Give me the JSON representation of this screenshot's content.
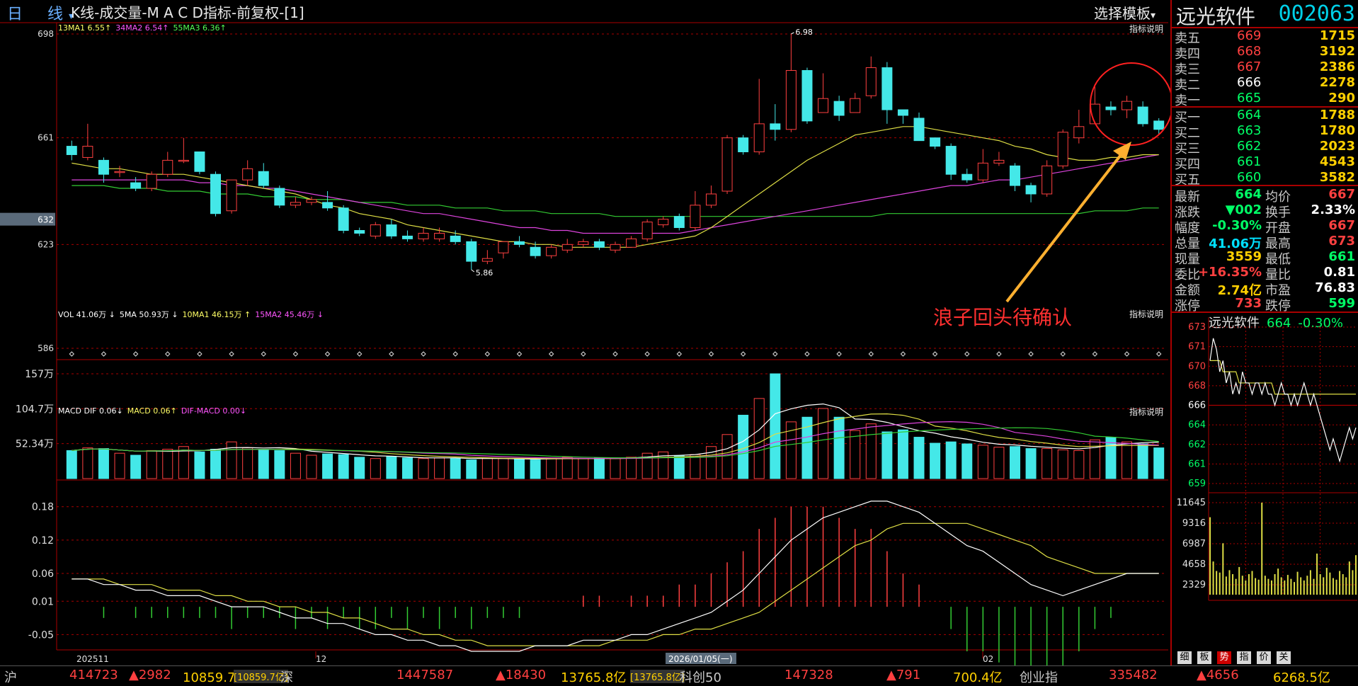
{
  "topbar": {
    "period_label": "日 线",
    "title": "K线-成交量-M A C D指标-前复权-[1]",
    "template_button": "选择模板",
    "dropdown_glyph": "▾"
  },
  "stock": {
    "name": "远光软件",
    "code": "002063"
  },
  "legends": {
    "ma": [
      {
        "text": "13MA1 6.55↑",
        "color": "#ffff66"
      },
      {
        "text": "34MA2 6.54↑",
        "color": "#ff55ff"
      },
      {
        "text": "55MA3 6.36↑",
        "color": "#55ff55"
      }
    ],
    "vol": [
      {
        "text": "VOL 41.06万 ↓",
        "color": "#ffffff"
      },
      {
        "text": "5MA 50.93万 ↓",
        "color": "#ffffff"
      },
      {
        "text": "10MA1 46.15万 ↑",
        "color": "#ffff66"
      },
      {
        "text": "15MA2 45.46万 ↓",
        "color": "#ff55ff"
      }
    ],
    "macd": [
      {
        "text": "MACD DIF 0.06↓",
        "color": "#ffffff"
      },
      {
        "text": "MACD 0.06↑",
        "color": "#ffff66"
      },
      {
        "text": "DIF-MACD 0.00↓",
        "color": "#ff55ff"
      }
    ],
    "explain": "指标说明"
  },
  "axis": {
    "price_ticks": [
      "698",
      "661",
      "632",
      "623",
      "586"
    ],
    "vol_ticks": [
      "157万",
      "104.7万",
      "52.34万"
    ],
    "macd_ticks": [
      "0.18",
      "0.12",
      "0.06",
      "0.01",
      "-0.05"
    ],
    "date_labels": [
      "202511",
      "12",
      "2026/01/05(一)",
      "02"
    ],
    "high_label": "6.98",
    "low_label": "5.86"
  },
  "annotation": {
    "text": "浪子回头待确认"
  },
  "chart_data": {
    "type": "candlestick",
    "price_ylim": [
      5.86,
      6.98
    ],
    "candles": [
      [
        6.58,
        6.55,
        6.6,
        6.53
      ],
      [
        6.54,
        6.58,
        6.66,
        6.53
      ],
      [
        6.53,
        6.48,
        6.54,
        6.45
      ],
      [
        6.49,
        6.49,
        6.51,
        6.47
      ],
      [
        6.45,
        6.43,
        6.47,
        6.42
      ],
      [
        6.43,
        6.48,
        6.49,
        6.42
      ],
      [
        6.48,
        6.53,
        6.56,
        6.47
      ],
      [
        6.53,
        6.53,
        6.61,
        6.52
      ],
      [
        6.56,
        6.49,
        6.56,
        6.48
      ],
      [
        6.48,
        6.34,
        6.49,
        6.33
      ],
      [
        6.35,
        6.46,
        6.46,
        6.34
      ],
      [
        6.46,
        6.5,
        6.53,
        6.44
      ],
      [
        6.49,
        6.44,
        6.52,
        6.43
      ],
      [
        6.43,
        6.37,
        6.44,
        6.36
      ],
      [
        6.37,
        6.38,
        6.4,
        6.36
      ],
      [
        6.38,
        6.39,
        6.4,
        6.37
      ],
      [
        6.38,
        6.36,
        6.42,
        6.35
      ],
      [
        6.36,
        6.28,
        6.37,
        6.27
      ],
      [
        6.28,
        6.27,
        6.29,
        6.26
      ],
      [
        6.26,
        6.3,
        6.31,
        6.25
      ],
      [
        6.3,
        6.26,
        6.32,
        6.25
      ],
      [
        6.26,
        6.25,
        6.28,
        6.24
      ],
      [
        6.25,
        6.27,
        6.29,
        6.24
      ],
      [
        6.25,
        6.27,
        6.29,
        6.24
      ],
      [
        6.26,
        6.24,
        6.28,
        6.23
      ],
      [
        6.24,
        6.17,
        6.25,
        6.14
      ],
      [
        6.17,
        6.18,
        6.21,
        6.16
      ],
      [
        6.2,
        6.24,
        6.24,
        6.18
      ],
      [
        6.24,
        6.23,
        6.26,
        6.22
      ],
      [
        6.22,
        6.19,
        6.24,
        6.18
      ],
      [
        6.19,
        6.22,
        6.23,
        6.18
      ],
      [
        6.21,
        6.23,
        6.25,
        6.2
      ],
      [
        6.23,
        6.24,
        6.25,
        6.22
      ],
      [
        6.24,
        6.22,
        6.25,
        6.21
      ],
      [
        6.21,
        6.23,
        6.24,
        6.2
      ],
      [
        6.22,
        6.25,
        6.26,
        6.22
      ],
      [
        6.25,
        6.31,
        6.32,
        6.24
      ],
      [
        6.3,
        6.32,
        6.33,
        6.29
      ],
      [
        6.33,
        6.29,
        6.34,
        6.28
      ],
      [
        6.29,
        6.37,
        6.42,
        6.28
      ],
      [
        6.37,
        6.41,
        6.44,
        6.36
      ],
      [
        6.42,
        6.61,
        6.62,
        6.41
      ],
      [
        6.61,
        6.56,
        6.62,
        6.55
      ],
      [
        6.56,
        6.66,
        6.82,
        6.55
      ],
      [
        6.66,
        6.64,
        6.73,
        6.6
      ],
      [
        6.64,
        6.85,
        6.98,
        6.63
      ],
      [
        6.85,
        6.67,
        6.86,
        6.66
      ],
      [
        6.7,
        6.75,
        6.84,
        6.7
      ],
      [
        6.74,
        6.69,
        6.76,
        6.67
      ],
      [
        6.7,
        6.75,
        6.77,
        6.7
      ],
      [
        6.76,
        6.86,
        6.9,
        6.75
      ],
      [
        6.86,
        6.71,
        6.88,
        6.66
      ],
      [
        6.71,
        6.69,
        6.71,
        6.66
      ],
      [
        6.68,
        6.6,
        6.7,
        6.6
      ],
      [
        6.61,
        6.58,
        6.61,
        6.57
      ],
      [
        6.58,
        6.48,
        6.59,
        6.46
      ],
      [
        6.48,
        6.46,
        6.5,
        6.45
      ],
      [
        6.46,
        6.52,
        6.57,
        6.45
      ],
      [
        6.52,
        6.53,
        6.56,
        6.51
      ],
      [
        6.51,
        6.44,
        6.52,
        6.42
      ],
      [
        6.44,
        6.41,
        6.45,
        6.38
      ],
      [
        6.41,
        6.51,
        6.53,
        6.4
      ],
      [
        6.51,
        6.63,
        6.64,
        6.5
      ],
      [
        6.61,
        6.65,
        6.71,
        6.59
      ],
      [
        6.66,
        6.73,
        6.8,
        6.66
      ],
      [
        6.72,
        6.71,
        6.74,
        6.69
      ],
      [
        6.71,
        6.74,
        6.76,
        6.68
      ],
      [
        6.72,
        6.66,
        6.74,
        6.65
      ],
      [
        6.67,
        6.64,
        6.68,
        6.62
      ]
    ],
    "volume": [
      42,
      46,
      45,
      38,
      35,
      42,
      44,
      48,
      40,
      44,
      55,
      46,
      44,
      42,
      38,
      35,
      37,
      36,
      32,
      30,
      33,
      31,
      30,
      31,
      30,
      28,
      31,
      30,
      29,
      28,
      30,
      32,
      30,
      31,
      30,
      32,
      38,
      40,
      34,
      36,
      48,
      66,
      95,
      120,
      157,
      85,
      92,
      105,
      92,
      72,
      82,
      70,
      73,
      62,
      53,
      55,
      52,
      50,
      47,
      48,
      45,
      45,
      43,
      42,
      58,
      62,
      55,
      52,
      46
    ],
    "volume_ylim": [
      0,
      157
    ],
    "ma13": [
      6.52,
      6.51,
      6.5,
      6.5,
      6.49,
      6.48,
      6.48,
      6.48,
      6.47,
      6.46,
      6.45,
      6.44,
      6.43,
      6.42,
      6.41,
      6.39,
      6.37,
      6.36,
      6.34,
      6.33,
      6.32,
      6.3,
      6.29,
      6.28,
      6.27,
      6.26,
      6.25,
      6.24,
      6.24,
      6.23,
      6.23,
      6.22,
      6.22,
      6.22,
      6.22,
      6.22,
      6.23,
      6.24,
      6.25,
      6.26,
      6.29,
      6.33,
      6.37,
      6.41,
      6.45,
      6.49,
      6.53,
      6.56,
      6.59,
      6.62,
      6.63,
      6.64,
      6.65,
      6.65,
      6.64,
      6.63,
      6.62,
      6.61,
      6.6,
      6.58,
      6.57,
      6.55,
      6.54,
      6.53,
      6.53,
      6.54,
      6.54,
      6.55,
      6.55
    ],
    "ma34": [
      6.46,
      6.46,
      6.46,
      6.46,
      6.46,
      6.46,
      6.46,
      6.46,
      6.45,
      6.45,
      6.44,
      6.44,
      6.43,
      6.43,
      6.42,
      6.41,
      6.4,
      6.39,
      6.38,
      6.37,
      6.36,
      6.35,
      6.34,
      6.34,
      6.33,
      6.32,
      6.31,
      6.3,
      6.29,
      6.29,
      6.28,
      6.28,
      6.27,
      6.27,
      6.27,
      6.27,
      6.27,
      6.27,
      6.27,
      6.28,
      6.29,
      6.3,
      6.31,
      6.32,
      6.33,
      6.34,
      6.35,
      6.36,
      6.37,
      6.38,
      6.39,
      6.4,
      6.41,
      6.42,
      6.43,
      6.44,
      6.44,
      6.45,
      6.46,
      6.46,
      6.47,
      6.48,
      6.49,
      6.5,
      6.51,
      6.52,
      6.53,
      6.54,
      6.55
    ],
    "ma55": [
      6.44,
      6.44,
      6.44,
      6.43,
      6.43,
      6.43,
      6.42,
      6.42,
      6.42,
      6.41,
      6.41,
      6.41,
      6.4,
      6.4,
      6.4,
      6.39,
      6.39,
      6.39,
      6.38,
      6.38,
      6.38,
      6.37,
      6.37,
      6.37,
      6.36,
      6.36,
      6.36,
      6.35,
      6.35,
      6.35,
      6.34,
      6.34,
      6.34,
      6.34,
      6.33,
      6.33,
      6.33,
      6.33,
      6.33,
      6.33,
      6.33,
      6.33,
      6.33,
      6.33,
      6.33,
      6.33,
      6.33,
      6.33,
      6.33,
      6.33,
      6.33,
      6.34,
      6.34,
      6.34,
      6.34,
      6.34,
      6.34,
      6.34,
      6.34,
      6.34,
      6.34,
      6.34,
      6.34,
      6.34,
      6.35,
      6.35,
      6.35,
      6.36,
      6.36
    ],
    "macd_ylim": [
      -0.08,
      0.2
    ],
    "dif": [
      0.05,
      0.05,
      0.04,
      0.04,
      0.03,
      0.03,
      0.02,
      0.02,
      0.02,
      0.01,
      0.0,
      0.0,
      0.0,
      -0.01,
      -0.02,
      -0.02,
      -0.03,
      -0.03,
      -0.04,
      -0.05,
      -0.05,
      -0.06,
      -0.06,
      -0.07,
      -0.07,
      -0.08,
      -0.08,
      -0.08,
      -0.08,
      -0.07,
      -0.07,
      -0.07,
      -0.06,
      -0.06,
      -0.06,
      -0.05,
      -0.05,
      -0.04,
      -0.03,
      -0.02,
      -0.01,
      0.01,
      0.03,
      0.06,
      0.09,
      0.12,
      0.14,
      0.16,
      0.17,
      0.18,
      0.19,
      0.19,
      0.18,
      0.17,
      0.15,
      0.13,
      0.11,
      0.1,
      0.08,
      0.06,
      0.04,
      0.03,
      0.02,
      0.03,
      0.04,
      0.05,
      0.06,
      0.06,
      0.06
    ],
    "dea": [
      0.05,
      0.05,
      0.05,
      0.04,
      0.04,
      0.04,
      0.03,
      0.03,
      0.03,
      0.02,
      0.02,
      0.01,
      0.01,
      0.0,
      0.0,
      -0.01,
      -0.01,
      -0.02,
      -0.02,
      -0.03,
      -0.04,
      -0.04,
      -0.05,
      -0.05,
      -0.06,
      -0.06,
      -0.07,
      -0.07,
      -0.07,
      -0.07,
      -0.07,
      -0.07,
      -0.07,
      -0.07,
      -0.06,
      -0.06,
      -0.06,
      -0.05,
      -0.05,
      -0.04,
      -0.04,
      -0.03,
      -0.02,
      -0.01,
      0.01,
      0.03,
      0.05,
      0.07,
      0.09,
      0.11,
      0.12,
      0.14,
      0.15,
      0.15,
      0.15,
      0.15,
      0.15,
      0.14,
      0.13,
      0.12,
      0.11,
      0.09,
      0.08,
      0.07,
      0.06,
      0.06,
      0.06,
      0.06,
      0.06
    ]
  },
  "orderbook": {
    "asks": [
      {
        "label": "卖五",
        "price": "669",
        "vol": "1715",
        "color": "#ff4040"
      },
      {
        "label": "卖四",
        "price": "668",
        "vol": "3192",
        "color": "#ff4040"
      },
      {
        "label": "卖三",
        "price": "667",
        "vol": "2386",
        "color": "#ff4040"
      },
      {
        "label": "卖二",
        "price": "666",
        "vol": "2278",
        "color": "#ffffff"
      },
      {
        "label": "卖一",
        "price": "665",
        "vol": "290",
        "color": "#00ff66"
      }
    ],
    "bids": [
      {
        "label": "买一",
        "price": "664",
        "vol": "1788",
        "color": "#00ff66"
      },
      {
        "label": "买二",
        "price": "663",
        "vol": "1780",
        "color": "#00ff66"
      },
      {
        "label": "买三",
        "price": "662",
        "vol": "2023",
        "color": "#00ff66"
      },
      {
        "label": "买四",
        "price": "661",
        "vol": "4543",
        "color": "#00ff66"
      },
      {
        "label": "买五",
        "price": "660",
        "vol": "3582",
        "color": "#00ff66"
      }
    ]
  },
  "quote": [
    {
      "l1": "最新",
      "v1": "664",
      "c1": "#00ff66",
      "l2": "均价",
      "v2": "667",
      "c2": "#ff4040"
    },
    {
      "l1": "涨跌",
      "v1": "▼002",
      "c1": "#00ff66",
      "l2": "换手",
      "v2": "2.33%",
      "c2": "#ffffff"
    },
    {
      "l1": "幅度",
      "v1": "-0.30%",
      "c1": "#00ff66",
      "l2": "开盘",
      "v2": "667",
      "c2": "#ff4040"
    },
    {
      "l1": "总量",
      "v1": "41.06万",
      "c1": "#00e0ff",
      "l2": "最高",
      "v2": "673",
      "c2": "#ff4040"
    },
    {
      "l1": "现量",
      "v1": "3559",
      "c1": "#ffd000",
      "l2": "最低",
      "v2": "661",
      "c2": "#00ff66"
    },
    {
      "l1": "委比",
      "v1": "+16.35%",
      "c1": "#ff4040",
      "l2": "量比",
      "v2": "0.81",
      "c2": "#ffffff"
    },
    {
      "l1": "金额",
      "v1": "2.74亿",
      "c1": "#ffd000",
      "l2": "市盈",
      "v2": "76.83",
      "c2": "#ffffff"
    },
    {
      "l1": "涨停",
      "v1": "733",
      "c1": "#ff4040",
      "l2": "跌停",
      "v2": "599",
      "c2": "#00ff66"
    }
  ],
  "mini": {
    "name": "远光软件",
    "price": "664",
    "change": "-0.30%",
    "price_ticks": [
      {
        "t": "673",
        "c": "#ff4040"
      },
      {
        "t": "671",
        "c": "#ff4040"
      },
      {
        "t": "670",
        "c": "#ff4040"
      },
      {
        "t": "668",
        "c": "#ff4040"
      },
      {
        "t": "666",
        "c": "#ffffff"
      },
      {
        "t": "664",
        "c": "#00ff66"
      },
      {
        "t": "662",
        "c": "#00ff66"
      },
      {
        "t": "661",
        "c": "#00ff66"
      },
      {
        "t": "659",
        "c": "#00ff66"
      }
    ],
    "vol_ticks": [
      "11645",
      "9316",
      "6987",
      "4658",
      "2329"
    ],
    "price_range": [
      6.59,
      6.73
    ],
    "prev_close": 6.66,
    "intraday_price": [
      6.7,
      6.72,
      6.71,
      6.69,
      6.7,
      6.68,
      6.69,
      6.67,
      6.68,
      6.67,
      6.69,
      6.68,
      6.68,
      6.67,
      6.68,
      6.68,
      6.67,
      6.68,
      6.67,
      6.67,
      6.66,
      6.67,
      6.68,
      6.67,
      6.67,
      6.66,
      6.67,
      6.66,
      6.67,
      6.68,
      6.67,
      6.66,
      6.67,
      6.66,
      6.65,
      6.64,
      6.63,
      6.62,
      6.63,
      6.62,
      6.61,
      6.62,
      6.63,
      6.64,
      6.63,
      6.64
    ],
    "intraday_avg": [
      6.7,
      6.7,
      6.7,
      6.7,
      6.69,
      6.69,
      6.69,
      6.69,
      6.69,
      6.68,
      6.68,
      6.68,
      6.68,
      6.68,
      6.68,
      6.68,
      6.68,
      6.68,
      6.68,
      6.68,
      6.67,
      6.67,
      6.67,
      6.67,
      6.67,
      6.67,
      6.67,
      6.67,
      6.67,
      6.67,
      6.67,
      6.67,
      6.67,
      6.67,
      6.67,
      6.67,
      6.67,
      6.67,
      6.67,
      6.67,
      6.67,
      6.67,
      6.67,
      6.67,
      6.67,
      6.67
    ],
    "intraday_vol": [
      9800,
      4200,
      3000,
      2800,
      6500,
      2300,
      3100,
      2600,
      2000,
      3500,
      2400,
      1800,
      2600,
      3000,
      2100,
      1900,
      11645,
      2400,
      2000,
      1800,
      2600,
      3300,
      2200,
      1800,
      2500,
      2000,
      1600,
      2900,
      2200,
      1800,
      2400,
      3100,
      2000,
      5200,
      2600,
      2200,
      3400,
      2800,
      2100,
      1900,
      3000,
      2600,
      2200,
      4200,
      3100,
      5000
    ],
    "vol_max": 11645
  },
  "tabs": [
    {
      "label": "细",
      "active": false
    },
    {
      "label": "板",
      "active": false
    },
    {
      "label": "势",
      "active": true
    },
    {
      "label": "指",
      "active": false
    },
    {
      "label": "价",
      "active": false
    },
    {
      "label": "关",
      "active": false
    }
  ],
  "statusbar": [
    {
      "t": "沪",
      "c": "#c8c8c8"
    },
    {
      "t": "414723",
      "c": "#ff4040"
    },
    {
      "t": "▲2982",
      "c": "#ff4040"
    },
    {
      "t": "10859.7亿",
      "c": "#ffd000"
    },
    {
      "t": "[10859.7亿]",
      "c": "#ffd000"
    },
    {
      "t": "深",
      "c": "#c8c8c8"
    },
    {
      "t": "1447587",
      "c": "#ff4040"
    },
    {
      "t": "▲18430",
      "c": "#ff4040"
    },
    {
      "t": "13765.8亿",
      "c": "#ffd000"
    },
    {
      "t": "[13765.8亿]",
      "c": "#ffd000"
    },
    {
      "t": "科创50",
      "c": "#c8c8c8"
    },
    {
      "t": "147328",
      "c": "#ff4040"
    },
    {
      "t": "▲791",
      "c": "#ff4040"
    },
    {
      "t": "700.4亿",
      "c": "#ffd000"
    },
    {
      "t": "创业指",
      "c": "#c8c8c8"
    },
    {
      "t": "335482",
      "c": "#ff4040"
    },
    {
      "t": "▲4656",
      "c": "#ff4040"
    },
    {
      "t": "6268.5亿",
      "c": "#ffd000"
    }
  ]
}
